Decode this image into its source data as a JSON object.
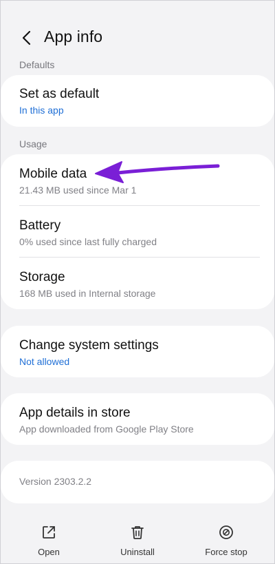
{
  "header": {
    "title": "App info"
  },
  "sections": {
    "defaults_label": "Defaults",
    "usage_label": "Usage"
  },
  "defaults_card": {
    "title": "Set as default",
    "subtitle": "In this app"
  },
  "usage_card": {
    "items": [
      {
        "title": "Mobile data",
        "subtitle": "21.43 MB used since Mar 1"
      },
      {
        "title": "Battery",
        "subtitle": "0% used since last fully charged"
      },
      {
        "title": "Storage",
        "subtitle": "168 MB used in Internal storage"
      }
    ]
  },
  "system_card": {
    "title": "Change system settings",
    "subtitle": "Not allowed"
  },
  "store_card": {
    "title": "App details in store",
    "subtitle": "App downloaded from Google Play Store"
  },
  "version": "Version 2303.2.2",
  "actions": {
    "open": "Open",
    "uninstall": "Uninstall",
    "force_stop": "Force stop"
  },
  "colors": {
    "background": "#f3f3f5",
    "card": "#ffffff",
    "link": "#1f6fd6",
    "annotation_arrow": "#7a1fd6"
  },
  "icons": {
    "back": "chevron-left-icon",
    "open": "open-external-icon",
    "uninstall": "trash-icon",
    "force_stop": "force-stop-icon",
    "annotation": "annotation-arrow-icon"
  }
}
